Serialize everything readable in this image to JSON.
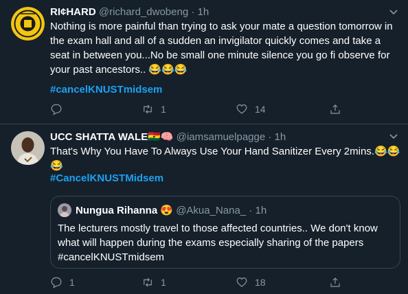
{
  "tweets": [
    {
      "display_name": "RI¢HARD",
      "handle": "@richard_dwobeng",
      "dot": "·",
      "time": "1h",
      "text_line1": "Nothing is more painful than trying to ask your mate a question tomorrow in",
      "text_line2": "the exam hall and all of a sudden an invigilator quickly comes and take a",
      "text_line3": "seat in between you...No be small one minute silence you go fi observe for",
      "text_line4": "your past ancestors.. 😂😂😂",
      "hashtag": "#cancelKNUSTmidsem",
      "reply_count": "",
      "retweet_count": "1",
      "like_count": "14"
    },
    {
      "display_name": "UCC SHATTA WALE🇬🇭🧠",
      "handle": "@iamsamuelpagge",
      "dot": "·",
      "time": "1h",
      "text_line1": "That's Why You Have To Always Use Your Hand Sanitizer Every 2mins.😂😂",
      "text_line2": "😂",
      "hashtag": "#CancelKNUSTMidsem",
      "quote": {
        "display_name": "Nungua Rihanna 😍",
        "handle": "@Akua_Nana_",
        "dot": "·",
        "time": "1h",
        "text_line1": "The lecturers mostly travel to those affected countries.. We don't know",
        "text_line2": "what will happen during the exams especially sharing of the papers",
        "text_line3": "#cancelKNUSTmidsem"
      },
      "reply_count": "1",
      "retweet_count": "1",
      "like_count": "18"
    }
  ],
  "icons": {
    "caret": "chevron-down-icon",
    "reply": "reply-icon",
    "retweet": "retweet-icon",
    "like": "heart-icon",
    "share": "share-icon"
  },
  "colors": {
    "background": "#15202b",
    "muted": "#8899a6",
    "accent": "#1da1f2",
    "divider": "#38444d"
  }
}
